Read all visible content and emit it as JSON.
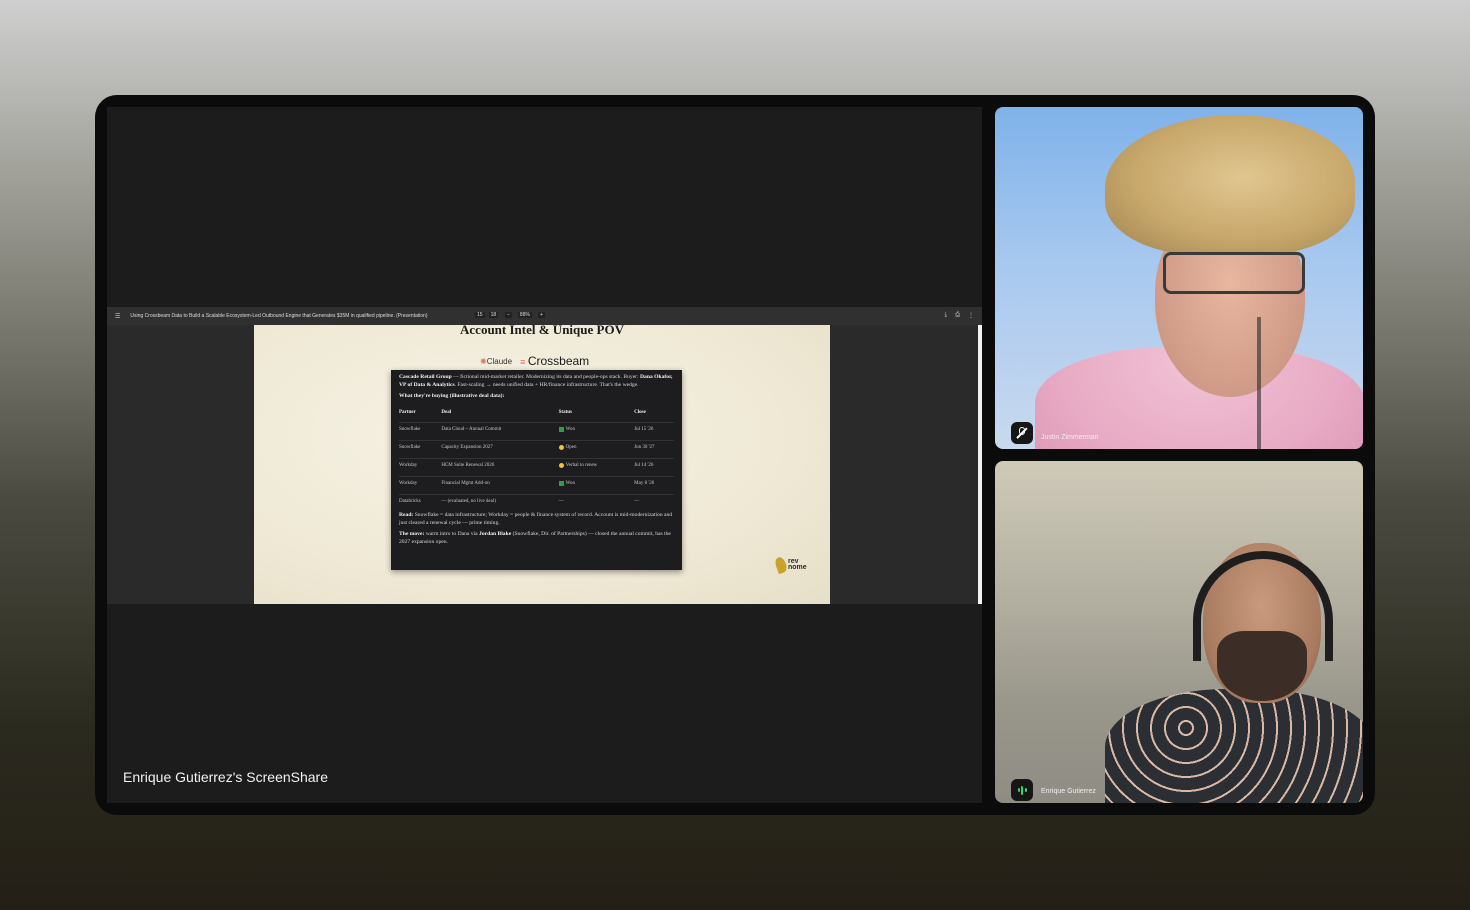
{
  "screenshare": {
    "label": "Enrique Gutierrez's ScreenShare",
    "toolbar": {
      "title": "Using Crossbeam Data to Build a Scalable Ecosystem-Led Outbound Engine that Generates $35M in qualified pipeline. (Presentation)",
      "page_current": "15",
      "page_total": "18",
      "zoom": "88%"
    },
    "slide": {
      "title": "Account Intel & Unique POV",
      "logo_claude": "Claude",
      "logo_crossbeam": "Crossbeam",
      "account_name": "Cascade Retail Group",
      "account_desc": " — fictional mid-market retailer. Modernizing its data and people-ops stack. Buyer: ",
      "buyer": "Dana Okafor, VP of Data & Analytics",
      "account_desc2": ". Fast-scaling → needs unified data + HR/finance infrastructure. That's the wedge.",
      "buying_heading": "What they're buying (illustrative deal data):",
      "table_headers": [
        "Partner",
        "Deal",
        "Status",
        "Close"
      ],
      "rows": [
        {
          "partner": "Snowflake",
          "deal": "Data Cloud – Annual Commit",
          "status": "Won",
          "close": "Jul 15 '26"
        },
        {
          "partner": "Snowflake",
          "deal": "Capacity Expansion 2027",
          "status": "Open",
          "close": "Jun 30 '27"
        },
        {
          "partner": "Workday",
          "deal": "HCM Suite Renewal 2026",
          "status": "Verbal to renew",
          "close": "Jul 14 '26"
        },
        {
          "partner": "Workday",
          "deal": "Financial Mgmt Add-on",
          "status": "Won",
          "close": "May 8 '26"
        },
        {
          "partner": "Databricks",
          "deal": "— (evaluated, no live deal)",
          "status": "—",
          "close": "—"
        }
      ],
      "read_label": "Read:",
      "read_text": " Snowflake = data infrastructure; Workday = people & finance system of record. Account is mid-modernization and just cleared a renewal cycle — prime timing.",
      "move_label": "The move:",
      "move_text1": " warm intro to Dana via ",
      "move_person": "Jordan Blake",
      "move_text2": " (Snowflake, Dir. of Partnerships) — closed the annual commit, has the 2027 expansion open.",
      "brand_line1": "rev",
      "brand_line2": "nome"
    }
  },
  "participants": [
    {
      "name": "Justin Zimmerman",
      "mic": "muted",
      "icon": "mic-off-icon"
    },
    {
      "name": "Enrique Gutierrez",
      "mic": "speaking",
      "icon": "speaking-icon"
    }
  ]
}
